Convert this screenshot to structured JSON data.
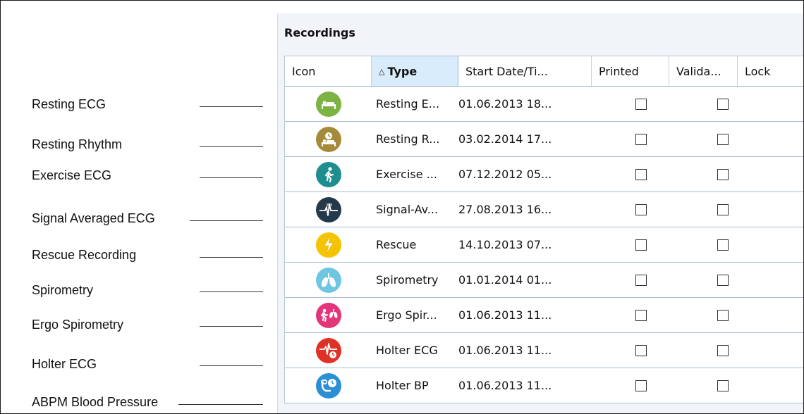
{
  "legend": [
    "Resting ECG",
    "Resting Rhythm",
    "Exercise ECG",
    "Signal Averaged ECG",
    "Rescue Recording",
    "Spirometry",
    "Ergo Spirometry",
    "Holter ECG",
    "ABPM Blood Pressure"
  ],
  "panel": {
    "title": "Recordings",
    "columns": {
      "icon": "Icon",
      "type": "Type",
      "start": "Start Date/Ti...",
      "printed": "Printed",
      "validated": "Valida...",
      "lock": "Lock"
    },
    "sort_indicator": "△",
    "rows": [
      {
        "icon": "resting-ecg-icon",
        "color": "#7cb342",
        "type": "Resting E...",
        "start": "01.06.2013 18...",
        "printed": false,
        "validated": false
      },
      {
        "icon": "resting-rhythm-icon",
        "color": "#a68a3c",
        "type": "Resting R...",
        "start": "03.02.2014 17...",
        "printed": false,
        "validated": false
      },
      {
        "icon": "exercise-ecg-icon",
        "color": "#1e8e8e",
        "type": "Exercise ...",
        "start": "07.12.2012 05...",
        "printed": false,
        "validated": false
      },
      {
        "icon": "signal-averaged-ecg-icon",
        "color": "#24394a",
        "type": "Signal-Av...",
        "start": "27.08.2013 16...",
        "printed": false,
        "validated": false
      },
      {
        "icon": "rescue-icon",
        "color": "#f5c400",
        "type": "Rescue",
        "start": "14.10.2013 07...",
        "printed": false,
        "validated": false
      },
      {
        "icon": "spirometry-icon",
        "color": "#6ec6e0",
        "type": "Spirometry",
        "start": "01.01.2014 01...",
        "printed": false,
        "validated": false
      },
      {
        "icon": "ergo-spirometry-icon",
        "color": "#e3357a",
        "type": "Ergo Spir...",
        "start": "01.06.2013 11...",
        "printed": false,
        "validated": false
      },
      {
        "icon": "holter-ecg-icon",
        "color": "#e03127",
        "type": "Holter ECG",
        "start": "01.06.2013 11...",
        "printed": false,
        "validated": false
      },
      {
        "icon": "holter-bp-icon",
        "color": "#2b8fd6",
        "type": "Holter BP",
        "start": "01.06.2013 11...",
        "printed": false,
        "validated": false
      }
    ]
  }
}
